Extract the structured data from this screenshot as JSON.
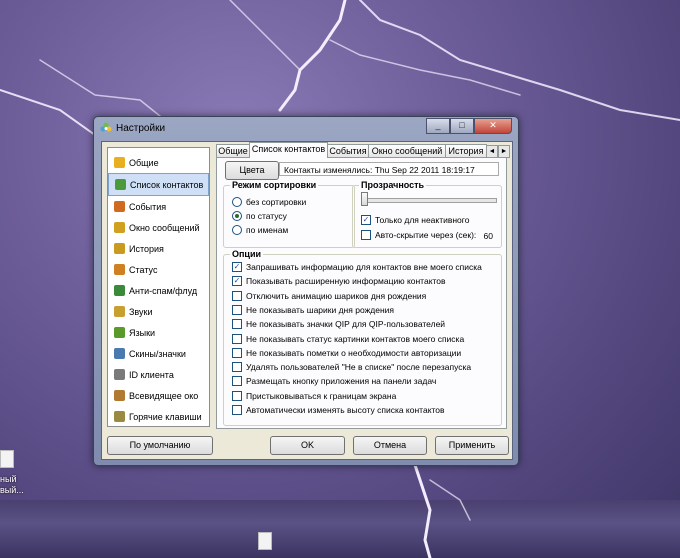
{
  "window": {
    "title": "Настройки",
    "controls": {
      "minimize": "_",
      "maximize": "□",
      "close": "✕"
    }
  },
  "sidebar": {
    "items": [
      {
        "label": "Общие",
        "icon": "sun-icon",
        "color": "#e8b020"
      },
      {
        "label": "Список контактов",
        "icon": "contacts-icon",
        "color": "#4a9a3a",
        "selected": true
      },
      {
        "label": "События",
        "icon": "events-icon",
        "color": "#d06a20"
      },
      {
        "label": "Окно сообщений",
        "icon": "message-window-icon",
        "color": "#d0a020"
      },
      {
        "label": "История",
        "icon": "history-icon",
        "color": "#c89a20"
      },
      {
        "label": "Статус",
        "icon": "status-icon",
        "color": "#d08020"
      },
      {
        "label": "Анти-спам/флуд",
        "icon": "antispam-icon",
        "color": "#3a8a3a"
      },
      {
        "label": "Звуки",
        "icon": "sound-icon",
        "color": "#c8a030"
      },
      {
        "label": "Языки",
        "icon": "languages-icon",
        "color": "#5a9a2a"
      },
      {
        "label": "Скины/значки",
        "icon": "skins-icon",
        "color": "#4a7ab0"
      },
      {
        "label": "ID клиента",
        "icon": "client-id-icon",
        "color": "#7a7a7a"
      },
      {
        "label": "Всевидящее око",
        "icon": "eye-icon",
        "color": "#b07a30"
      },
      {
        "label": "Горячие клавиши",
        "icon": "hotkeys-icon",
        "color": "#9a8a40"
      }
    ]
  },
  "tabs": [
    "Общие",
    "Список контактов",
    "События",
    "Окно сообщений",
    "История"
  ],
  "tab_arrows": {
    "left": "◄",
    "right": "►"
  },
  "panel": {
    "colors_button": "Цвета",
    "changed_text": "Контакты изменялись: Thu Sep 22 2011 18:19:17",
    "sort": {
      "title": "Режим сортировки",
      "options": [
        {
          "label": "без сортировки",
          "checked": false
        },
        {
          "label": "по статусу",
          "checked": true
        },
        {
          "label": "по именам",
          "checked": false
        }
      ]
    },
    "transparency": {
      "title": "Прозрачность",
      "slider_level": 0,
      "inactive_only": {
        "label": "Только для неактивного",
        "checked": true
      },
      "autohide": {
        "label": "Авто-скрытие через (сек):",
        "checked": false,
        "value": "60"
      }
    },
    "options": {
      "title": "Опции",
      "items": [
        {
          "label": "Запрашивать информацию для контактов вне моего списка",
          "checked": true
        },
        {
          "label": "Показывать расширенную информацию контактов",
          "checked": true
        },
        {
          "label": "Отключить анимацию шариков дня рождения",
          "checked": false
        },
        {
          "label": "Не показывать шарики дня рождения",
          "checked": false
        },
        {
          "label": "Не показывать значки QIP для QIP-пользователей",
          "checked": false
        },
        {
          "label": "Не показывать статус картинки контактов моего списка",
          "checked": false
        },
        {
          "label": "Не показывать пометки о необходимости авторизации",
          "checked": false
        },
        {
          "label": "Удалять пользователей \"Не в списке\" после перезапуска",
          "checked": false
        },
        {
          "label": "Размещать кнопку приложения на панели задач",
          "checked": false
        },
        {
          "label": "Пристыковываться к границам экрана",
          "checked": false
        },
        {
          "label": "Автоматически изменять высоту списка контактов",
          "checked": false
        }
      ]
    }
  },
  "buttons": {
    "default": "По умолчанию",
    "ok": "OK",
    "cancel": "Отмена",
    "apply": "Применить"
  },
  "desktop": {
    "icon_label_1": "ный",
    "icon_label_2": "вый..."
  }
}
